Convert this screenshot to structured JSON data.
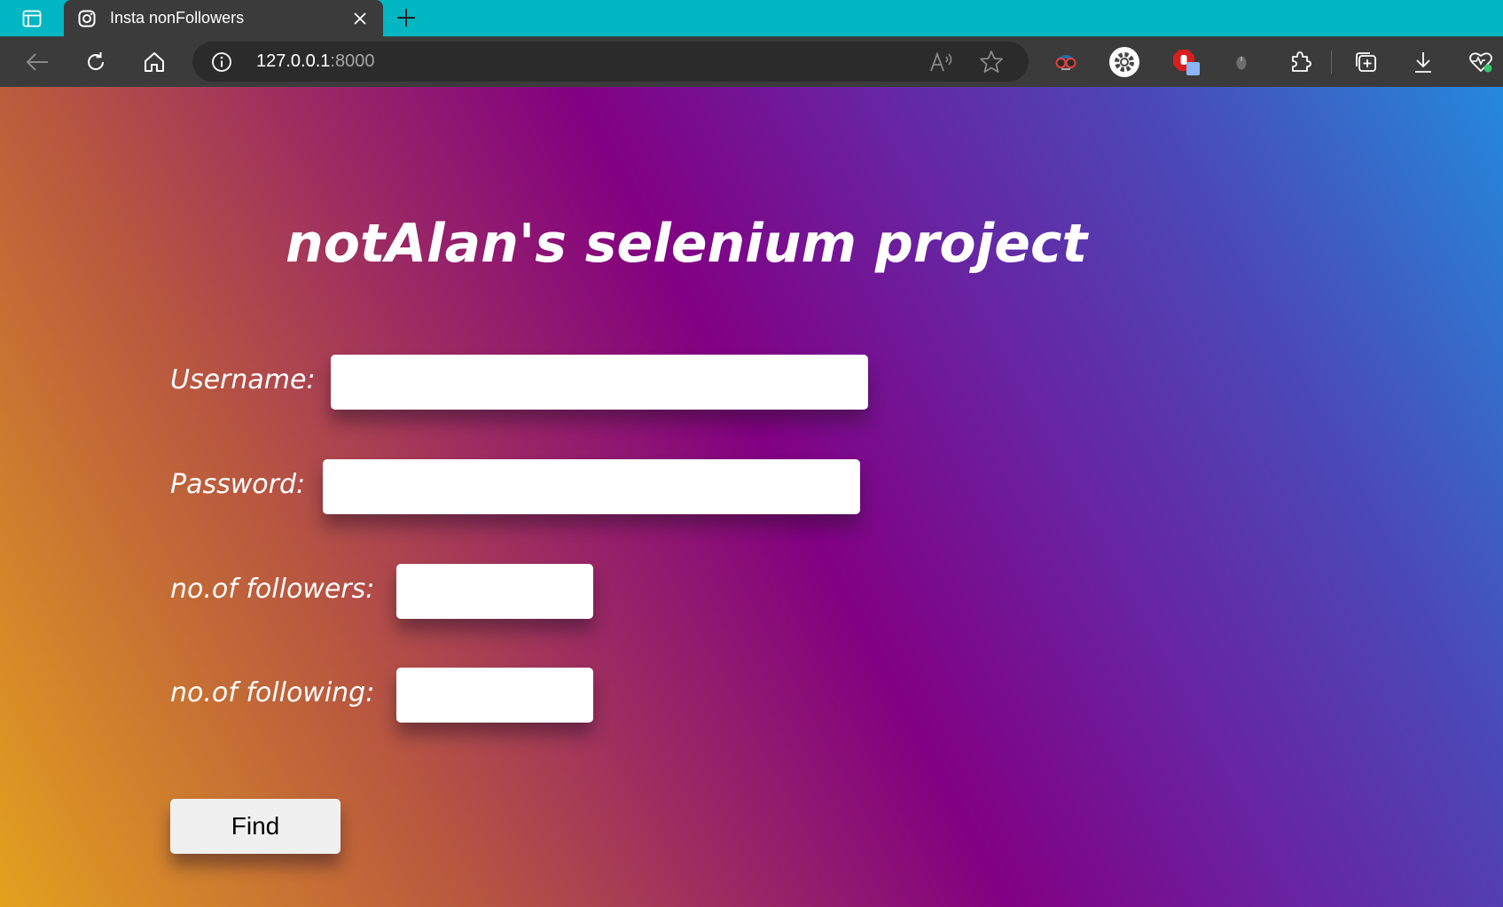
{
  "browser": {
    "tab": {
      "title": "Insta nonFollowers"
    },
    "address_bar": {
      "host": "127.0.0.1",
      "port": ":8000"
    }
  },
  "page": {
    "title": "notAlan's selenium project",
    "form": {
      "username_label": "Username:",
      "password_label": "Password:",
      "followers_label": "no.of followers:",
      "following_label": "no.of following:",
      "username_value": "",
      "password_value": "",
      "followers_value": "",
      "following_value": "",
      "find_label": "Find"
    }
  },
  "colors": {
    "tabstrip": "#00b7c3",
    "toolbar": "#3b3b3b",
    "gradient_start": "#e3a11e",
    "gradient_mid": "#820082",
    "gradient_end": "#2489db"
  }
}
